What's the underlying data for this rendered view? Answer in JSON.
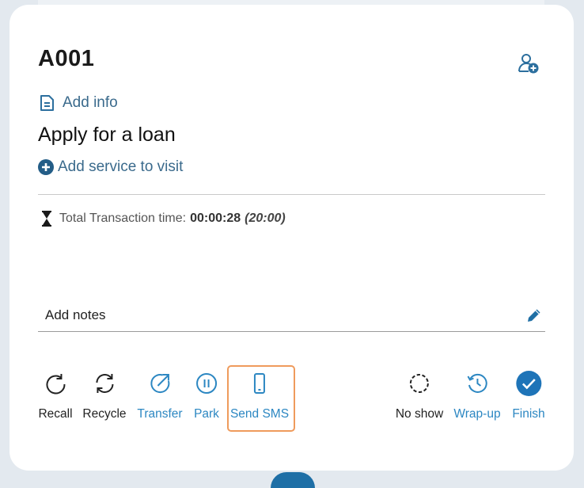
{
  "ticket": {
    "number": "A001"
  },
  "info": {
    "add_info_label": "Add info"
  },
  "service": {
    "name": "Apply for a loan",
    "add_service_label": "Add service to visit"
  },
  "transaction": {
    "label": "Total Transaction time:",
    "time": "00:00:28",
    "limit": "(20:00)"
  },
  "notes": {
    "label": "Add notes"
  },
  "actions": [
    {
      "label": "Recall",
      "icon": "recall-icon",
      "color": "dark"
    },
    {
      "label": "Recycle",
      "icon": "recycle-icon",
      "color": "dark"
    },
    {
      "label": "Transfer",
      "icon": "transfer-icon",
      "color": "blue"
    },
    {
      "label": "Park",
      "icon": "pause-icon",
      "color": "blue"
    },
    {
      "label": "Send SMS",
      "icon": "phone-icon",
      "color": "blue",
      "highlighted": true
    },
    {
      "label": "No show",
      "icon": "no-show-icon",
      "color": "dark"
    },
    {
      "label": "Wrap-up",
      "icon": "history-icon",
      "color": "blue"
    },
    {
      "label": "Finish",
      "icon": "check-circle-icon",
      "color": "blue"
    }
  ],
  "colors": {
    "accent": "#2c87c2",
    "link": "#3a6a8c",
    "finish_fill": "#1e74b8",
    "highlight": "#ef9b5c",
    "background": "#e3e9ef",
    "card": "#ffffff"
  }
}
